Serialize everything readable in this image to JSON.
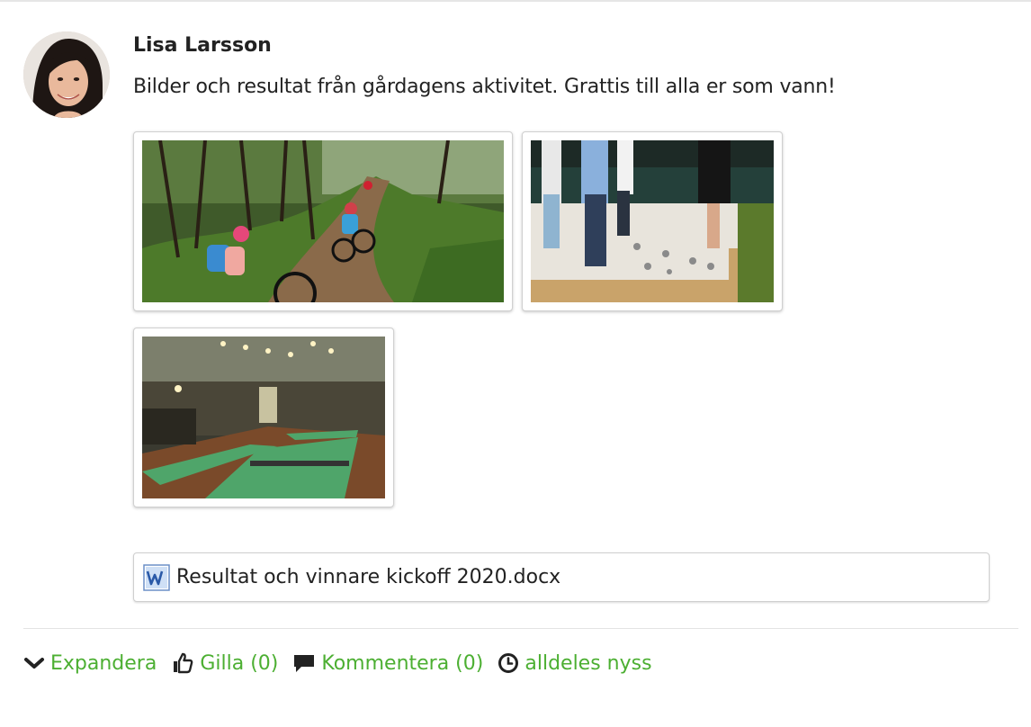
{
  "post": {
    "author": "Lisa Larsson",
    "text": "Bilder och resultat från gårdagens aktivitet. Grattis till alla er som vann!"
  },
  "images": [
    {
      "name": "mountain-bike-photo"
    },
    {
      "name": "boule-photo"
    },
    {
      "name": "shuffleboard-photo"
    }
  ],
  "attachment": {
    "icon": "word-document-icon",
    "filename": "Resultat och vinnare kickoff 2020.docx"
  },
  "actions": {
    "expand_label": "Expandera",
    "like_label": "Gilla (0)",
    "comment_label": "Kommentera (0)",
    "time_label": "alldeles nyss"
  },
  "colors": {
    "accent": "#4caf32",
    "text": "#222222",
    "word_blue": "#2b5aa8"
  }
}
